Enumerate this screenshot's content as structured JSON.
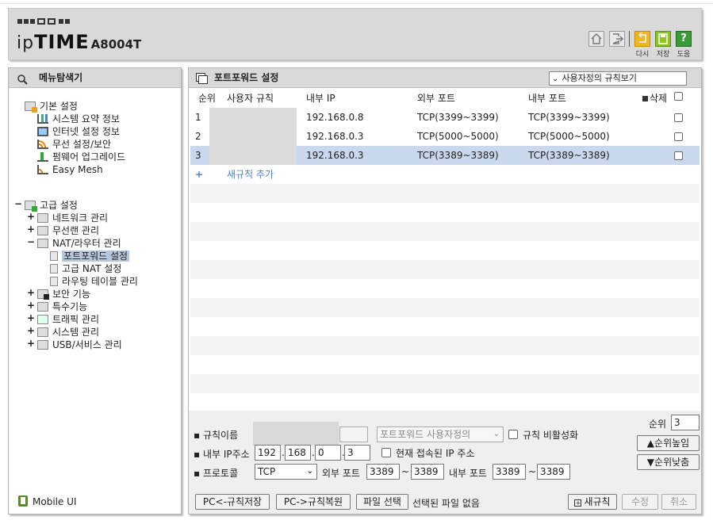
{
  "header": {
    "logo_ip": "ip",
    "logo_time": "TIME",
    "model": "A8004T",
    "icons": [
      {
        "name": "home-icon",
        "label": ""
      },
      {
        "name": "logout-icon",
        "label": ""
      },
      {
        "name": "reload-icon",
        "label": "다시"
      },
      {
        "name": "save-icon",
        "label": "저장"
      },
      {
        "name": "help-icon",
        "label": "도움"
      }
    ]
  },
  "sidebar": {
    "title": "메뉴탐색기",
    "basic": {
      "label": "기본 설정",
      "items": [
        "시스템 요약 정보",
        "인터넷 설정 정보",
        "무선 설정/보안",
        "펌웨어 업그레이드",
        "Easy Mesh"
      ]
    },
    "advanced": {
      "label": "고급 설정",
      "items": [
        {
          "label": "네트워크 관리",
          "expand": "+"
        },
        {
          "label": "무선랜 관리",
          "expand": "+"
        },
        {
          "label": "NAT/라우터 관리",
          "expand": "−"
        }
      ],
      "nat_items": [
        "포트포워드 설정",
        "고급 NAT 설정",
        "라우팅 테이블 관리"
      ],
      "more": [
        {
          "label": "보안 기능",
          "expand": "+"
        },
        {
          "label": "특수기능",
          "expand": "+"
        },
        {
          "label": "트래픽 관리",
          "expand": "+"
        },
        {
          "label": "시스템 관리",
          "expand": "+"
        },
        {
          "label": "USB/서비스 관리",
          "expand": "+"
        }
      ]
    },
    "mobile": "Mobile UI"
  },
  "main": {
    "title": "포트포워드 설정",
    "view_select": "사용자정의 규칙보기",
    "columns": {
      "no": "순위",
      "name": "사용자 규칙",
      "int_ip": "내부 IP",
      "ext_port": "외부 포트",
      "int_port": "내부 포트",
      "delete": "삭제"
    },
    "rows": [
      {
        "no": "1",
        "ip": "192.168.0.8",
        "ext": "TCP(3399~3399)",
        "int": "TCP(3399~3399)"
      },
      {
        "no": "2",
        "ip": "192.168.0.3",
        "ext": "TCP(5000~5000)",
        "int": "TCP(5000~5000)"
      },
      {
        "no": "3",
        "ip": "192.168.0.3",
        "ext": "TCP(3389~3389)",
        "int": "TCP(3389~3389)"
      }
    ],
    "add_rule": "새규칙 추가"
  },
  "form": {
    "rule_name_label": "규칙이름",
    "preset_select": "포트포워드 사용자정의",
    "disable_label": "규칙 비활성화",
    "ip_label": "내부 IP주소",
    "ip": [
      "192",
      "168",
      "0",
      "3"
    ],
    "current_ip_label": "현재 접속된 IP 주소",
    "protocol_label": "프로토콜",
    "protocol": "TCP",
    "ext_port_label": "외부 포트",
    "ext_from": "3389",
    "ext_to": "3389",
    "int_port_label": "내부 포트",
    "int_from": "3389",
    "int_to": "3389",
    "tilde": "~",
    "rank_label": "순위",
    "rank": "3",
    "up_btn": "▲순위높임",
    "down_btn": "▼순위낮춤",
    "save_pc": "PC<-규칙저장",
    "restore_pc": "PC->규칙복원",
    "file_select": "파일 선택",
    "no_file": "선택된 파일 없음",
    "new_rule": "새규칙",
    "modify": "수정",
    "cancel": "취소"
  }
}
